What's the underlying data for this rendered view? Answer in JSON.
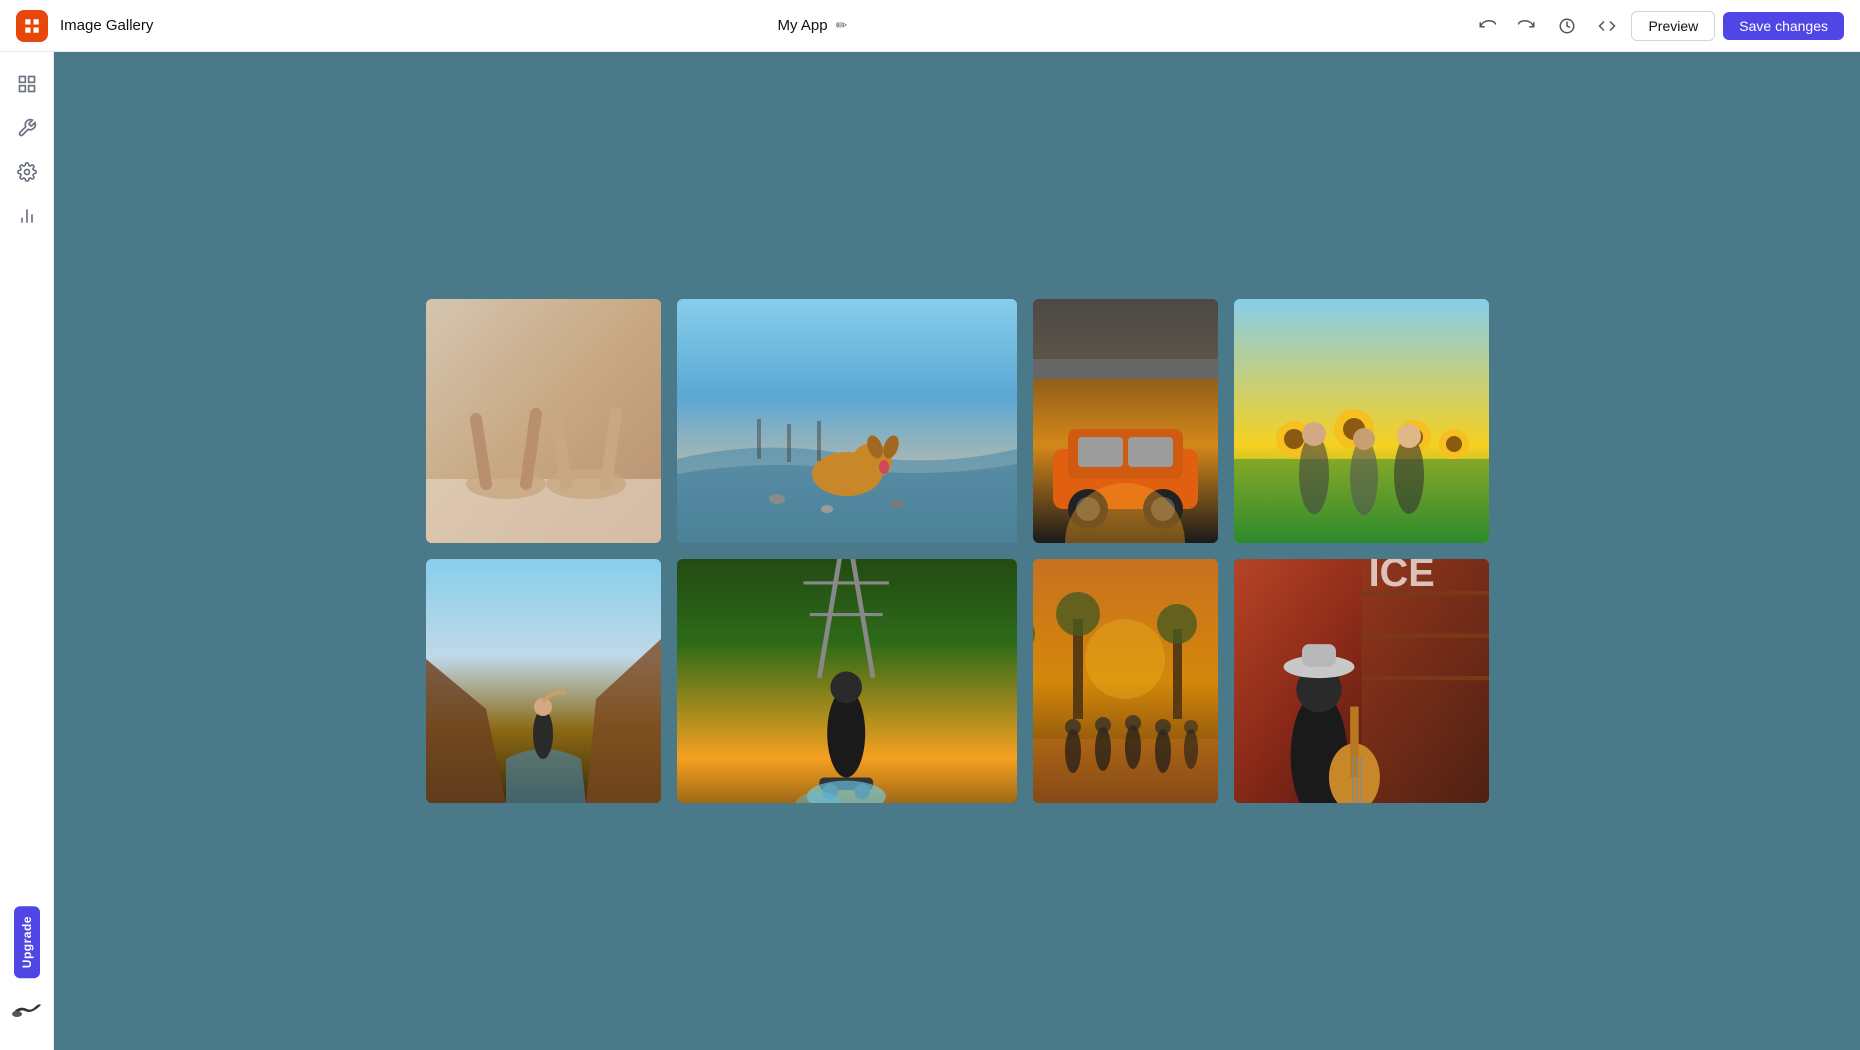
{
  "header": {
    "logo_label": "Image Gallery",
    "app_name": "Image Gallery",
    "title": "My App",
    "edit_icon": "✏",
    "preview_label": "Preview",
    "save_label": "Save changes"
  },
  "sidebar": {
    "items": [
      {
        "id": "grid",
        "label": "Grid view",
        "icon": "grid"
      },
      {
        "id": "tools",
        "label": "Tools",
        "icon": "tools"
      },
      {
        "id": "settings",
        "label": "Settings",
        "icon": "settings"
      },
      {
        "id": "analytics",
        "label": "Analytics",
        "icon": "analytics"
      }
    ],
    "upgrade_label": "Upgrade",
    "bottom_icon": "bird"
  },
  "gallery": {
    "images": [
      {
        "id": 1,
        "alt": "Two women lying on floor with legs up",
        "css_class": "img-1"
      },
      {
        "id": 2,
        "alt": "Golden retriever on rocky beach",
        "css_class": "img-2"
      },
      {
        "id": 3,
        "alt": "Orange sports car under concrete bridge at sunset",
        "css_class": "img-3"
      },
      {
        "id": 4,
        "alt": "Three women in sunflower field",
        "css_class": "img-4"
      },
      {
        "id": 5,
        "alt": "Woman at canyon overlook",
        "css_class": "img-5"
      },
      {
        "id": 6,
        "alt": "Skateboarder with smoke trick",
        "css_class": "img-6"
      },
      {
        "id": 7,
        "alt": "Group running in desert at golden hour",
        "css_class": "img-7"
      },
      {
        "id": 8,
        "alt": "Musician with guitar and hat",
        "css_class": "img-8"
      }
    ]
  }
}
